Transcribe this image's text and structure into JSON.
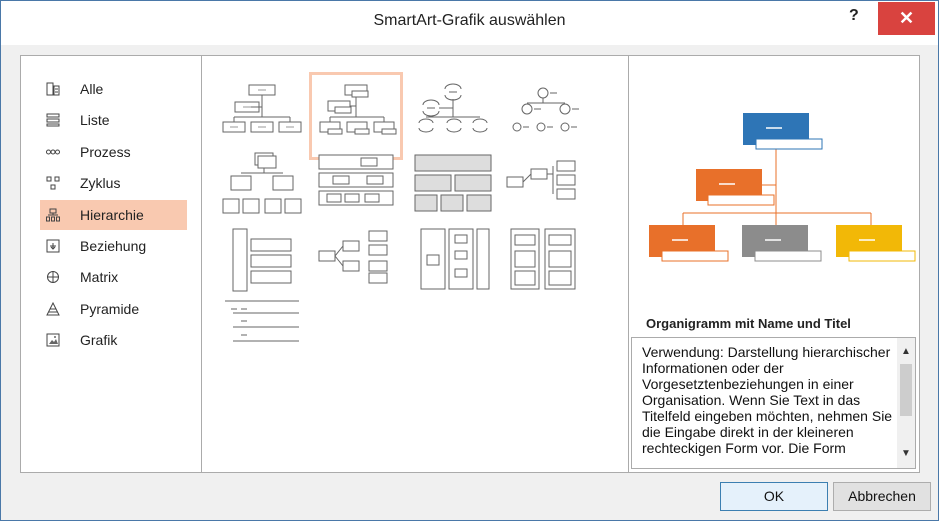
{
  "dialog": {
    "title": "SmartArt-Grafik auswählen",
    "help_label": "?",
    "close_label": "✕"
  },
  "categories": [
    {
      "label": "Alle",
      "icon": "all-icon"
    },
    {
      "label": "Liste",
      "icon": "list-icon"
    },
    {
      "label": "Prozess",
      "icon": "process-icon"
    },
    {
      "label": "Zyklus",
      "icon": "cycle-icon"
    },
    {
      "label": "Hierarchie",
      "icon": "hierarchy-icon",
      "selected": true
    },
    {
      "label": "Beziehung",
      "icon": "relationship-icon"
    },
    {
      "label": "Matrix",
      "icon": "matrix-icon"
    },
    {
      "label": "Pyramide",
      "icon": "pyramid-icon"
    },
    {
      "label": "Grafik",
      "icon": "picture-icon"
    }
  ],
  "gallery": {
    "selected_index": 1,
    "count": 13
  },
  "preview": {
    "title": "Organigramm mit Name und Titel",
    "description": "Verwendung: Darstellung hierarchischer Informationen oder der Vorgesetztenbeziehungen in einer Organisation. Wenn Sie Text in das Titelfeld eingeben möchten, nehmen Sie die Eingabe direkt in der kleineren rechteckigen Form vor. Die Form",
    "colors": {
      "top": "#2e75b6",
      "left": "#e8702a",
      "middle": "#8c8c8c",
      "right": "#f2b807"
    }
  },
  "buttons": {
    "ok": "OK",
    "cancel": "Abbrechen"
  },
  "accent": "#f9c9b0"
}
